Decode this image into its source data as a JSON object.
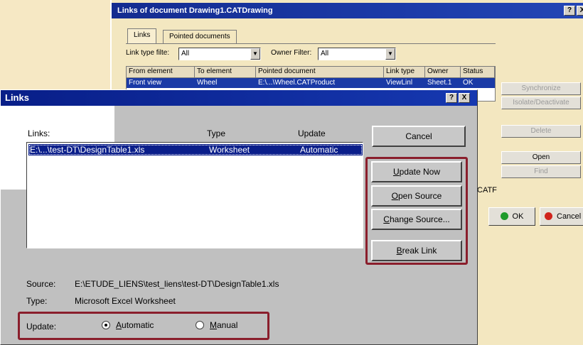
{
  "bg_dialog": {
    "title": "Links of document Drawing1.CATDrawing",
    "help_btn": "?",
    "close_btn": "X",
    "tabs": [
      "Links",
      "Pointed documents"
    ],
    "link_type_filter_label": "Link type filte:",
    "link_type_filter_value": "All",
    "owner_filter_label": "Owner Filter:",
    "owner_filter_value": "All",
    "table_headers": [
      "From element",
      "To element",
      "Pointed document",
      "Link type",
      "Owner",
      "Status"
    ],
    "table_row": [
      "Front view",
      "Wheel",
      "E:\\...\\Wheel.CATProduct",
      "ViewLinl",
      "Sheet.1",
      "OK"
    ],
    "side_buttons": [
      "Synchronize",
      "Isolate/Deactivate",
      "Delete",
      "Open",
      "Find"
    ],
    "catf_label": "CATF",
    "ok_label": "OK",
    "cancel_label": "Cancel",
    "colors": {
      "ok_dot": "#1f9a2a",
      "cancel_dot": "#d0241c"
    }
  },
  "dialog": {
    "title": "Links",
    "help_btn": "?",
    "close_btn": "X",
    "col_links": "Links:",
    "col_type": "Type",
    "col_update": "Update",
    "row": {
      "source": "E:\\...\\test-DT\\DesignTable1.xls",
      "type": "Worksheet",
      "update": "Automatic"
    },
    "cancel_label": "Cancel",
    "buttons": {
      "update_now": {
        "pre": "",
        "u": "U",
        "post": "pdate Now"
      },
      "open_source": {
        "pre": "",
        "u": "O",
        "post": "pen Source"
      },
      "change_source": {
        "pre": "",
        "u": "C",
        "post": "hange Source..."
      },
      "break_link": {
        "pre": "",
        "u": "B",
        "post": "reak Link"
      }
    },
    "source_label": "Source:",
    "source_value": "E:\\ETUDE_LIENS\\test_liens\\test-DT\\DesignTable1.xls",
    "type_label": "Type:",
    "type_value": "Microsoft Excel Worksheet",
    "update_label": "Update:",
    "radio_auto": {
      "pre": "",
      "u": "A",
      "post": "utomatic"
    },
    "radio_manual": {
      "pre": "",
      "u": "M",
      "post": "anual"
    },
    "update_mode": "Automatic",
    "highlight_color": "#8a1e2c"
  }
}
